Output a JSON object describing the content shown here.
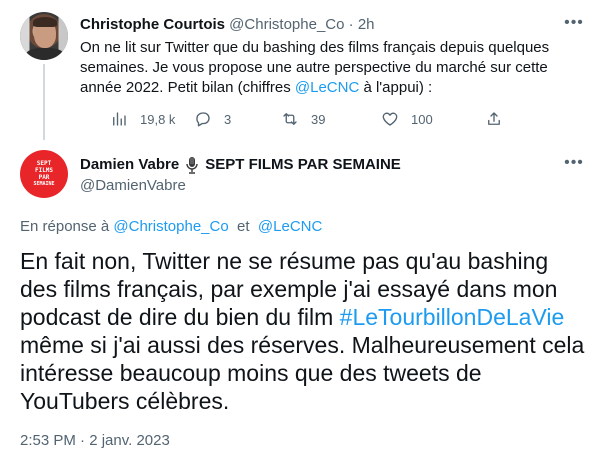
{
  "tweet1": {
    "author_name": "Christophe Courtois",
    "author_handle": "@Christophe_Co",
    "separator": "·",
    "time": "2h",
    "body_before_link": "On ne lit sur Twitter que du bashing des films français depuis quelques semaines. Je vous propose une autre perspective du marché sur cette année 2022. Petit bilan (chiffres ",
    "body_link": "@LeCNC",
    "body_after_link": " à l'appui) :",
    "actions": {
      "views": "19,8 k",
      "replies": "3",
      "retweets": "39",
      "likes": "100"
    }
  },
  "tweet2": {
    "author_name": "Damien Vabre",
    "author_tagline": "SEPT FILMS PAR SEMAINE",
    "author_handle": "@DamienVabre",
    "avatar_lines": [
      "SEPT",
      "FILMS",
      "PAR",
      "SEMAINE"
    ],
    "reply_prefix": "En réponse à",
    "reply_to_1": "@Christophe_Co",
    "reply_and": "et",
    "reply_to_2": "@LeCNC",
    "body_before_hashtag": "En fait non, Twitter ne se résume pas qu'au bashing des films français, par exemple j'ai essayé dans mon podcast de dire du bien du film ",
    "body_hashtag": "#LeTourbillonDeLaVie",
    "body_after_hashtag": " même si j'ai aussi des réserves. Malheureusement cela intéresse beaucoup moins que des tweets de YouTubers célèbres.",
    "timestamp": "2:53 PM · 2 janv. 2023"
  },
  "colors": {
    "link": "#1d9bf0",
    "secondary_text": "#536471",
    "avatar2_bg": "#e8262a",
    "thread_line": "#cfd9de"
  },
  "icons": [
    "more-icon",
    "views-icon",
    "reply-icon",
    "retweet-icon",
    "like-icon",
    "share-icon",
    "microphone-icon"
  ]
}
